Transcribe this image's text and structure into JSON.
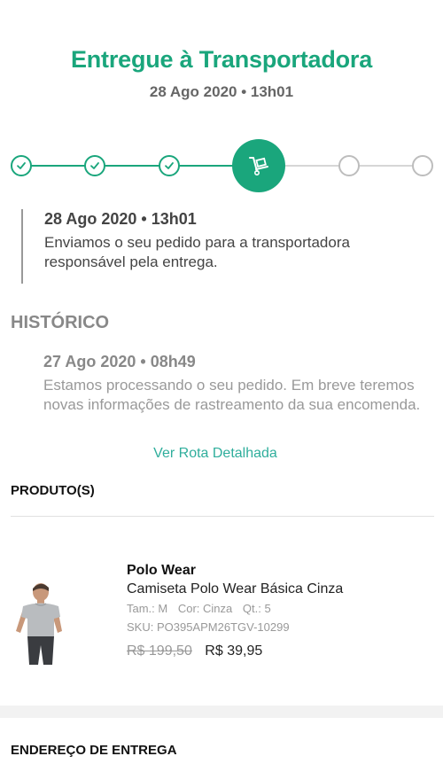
{
  "status": {
    "title": "Entregue à Transportadora",
    "datetime": "28 Ago 2020 • 13h01"
  },
  "stepper": {
    "steps": [
      "done",
      "done",
      "done",
      "current",
      "todo",
      "todo"
    ],
    "current_icon": "hand-truck-icon",
    "accent_color": "#1aa67c"
  },
  "current_event": {
    "datetime": "28 Ago 2020 • 13h01",
    "text": "Enviamos o seu pedido para a transportadora responsável pela entrega."
  },
  "history": {
    "title": "HISTÓRICO",
    "events": [
      {
        "datetime": "27 Ago 2020 • 08h49",
        "text": "Estamos processando o seu pedido. Em breve teremos novas informações de rastreamento da sua encomenda."
      }
    ],
    "route_link": "Ver Rota Detalhada"
  },
  "products_section": {
    "title": "PRODUTO(S)",
    "items": [
      {
        "brand": "Polo Wear",
        "name": "Camiseta Polo Wear Básica Cinza",
        "size_label": "Tam.: M",
        "color_label": "Cor: Cinza",
        "qty_label": "Qt.: 5",
        "sku": "SKU: PO395APM26TGV-10299",
        "old_price": "R$ 199,50",
        "price": "R$ 39,95"
      }
    ]
  },
  "address_section": {
    "title": "ENDEREÇO DE ENTREGA"
  }
}
